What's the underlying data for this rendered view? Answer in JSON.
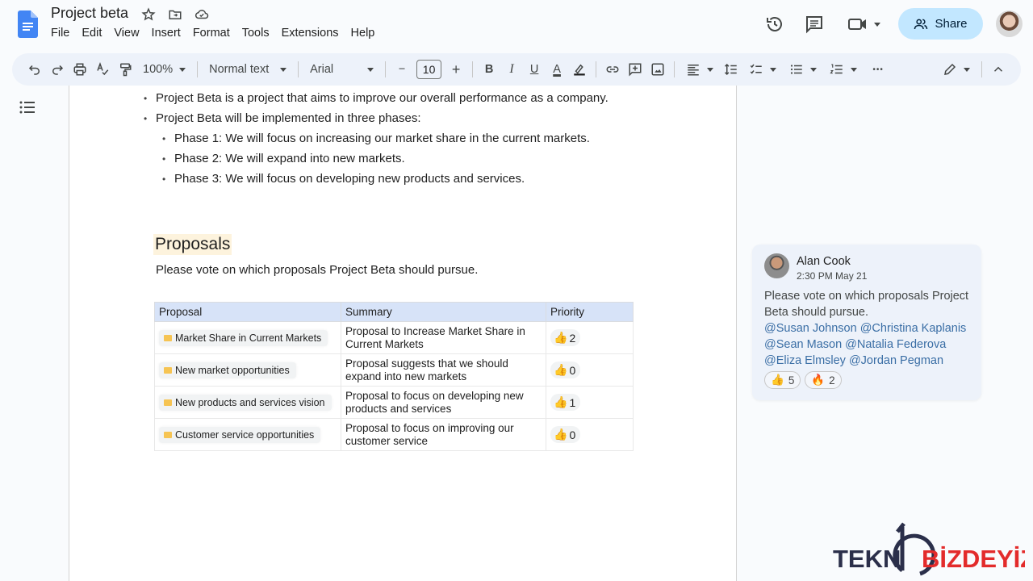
{
  "app": {
    "title": "Project beta",
    "menu": [
      "File",
      "Edit",
      "View",
      "Insert",
      "Format",
      "Tools",
      "Extensions",
      "Help"
    ],
    "title_icons": [
      "star-icon",
      "move-to-folder-icon",
      "cloud-saved-icon"
    ],
    "right_icons": [
      "version-history-icon",
      "comments-icon",
      "meet-icon"
    ],
    "share_label": "Share"
  },
  "toolbar": {
    "zoom": "100%",
    "style": "Normal text",
    "font": "Arial",
    "font_size": "10",
    "minus": "−",
    "plus": "+",
    "bold": "B",
    "italic": "I",
    "underline": "U",
    "text_color": "A",
    "more": "•••"
  },
  "document": {
    "bullets": [
      {
        "level": 1,
        "text": "Project Beta is a project that aims to improve our overall performance as a company."
      },
      {
        "level": 1,
        "text": "Project Beta will be implemented in three phases:"
      },
      {
        "level": 2,
        "text": "Phase 1: We will focus on increasing our market share in the current markets."
      },
      {
        "level": 2,
        "text": "Phase 2: We will expand into new markets."
      },
      {
        "level": 2,
        "text": "Phase 3: We will focus on developing new products and services."
      }
    ],
    "heading": "Proposals",
    "subtext": "Please vote on which proposals Project Beta should pursue.",
    "table": {
      "headers": [
        "Proposal",
        "Summary",
        "Priority"
      ],
      "rows": [
        {
          "proposal": "Market Share in Current Markets",
          "summary": "Proposal to Increase Market Share in Current Markets",
          "votes": "2"
        },
        {
          "proposal": "New market opportunities",
          "summary": "Proposal suggests that we should expand into new markets",
          "votes": "0"
        },
        {
          "proposal": "New products and services vision",
          "summary": "Proposal to focus on developing new products and services",
          "votes": "1"
        },
        {
          "proposal": "Customer service opportunities",
          "summary": "Proposal to focus on improving our customer service",
          "votes": "0"
        }
      ]
    }
  },
  "comment": {
    "author": "Alan Cook",
    "time": "2:30 PM May 21",
    "body": "Please vote on which proposals Project Beta should pursue.",
    "mentions": "@Susan Johnson @Christina Kaplanis @Sean Mason @Natalia Federova @Eliza Elmsley @Jordan Pegman",
    "reactions": [
      {
        "emoji": "👍",
        "count": "5"
      },
      {
        "emoji": "🔥",
        "count": "2"
      }
    ]
  },
  "watermark": {
    "left": "TEKN",
    "right": "BİZDEYİZ"
  },
  "colors": {
    "accent": "#0b57d0",
    "share_bg": "#c2e7ff",
    "toolbar_bg": "#edf2fa",
    "table_header": "#d7e3f8",
    "mention": "#3a6ea5",
    "heading_highlight": "#fdf3dd"
  }
}
